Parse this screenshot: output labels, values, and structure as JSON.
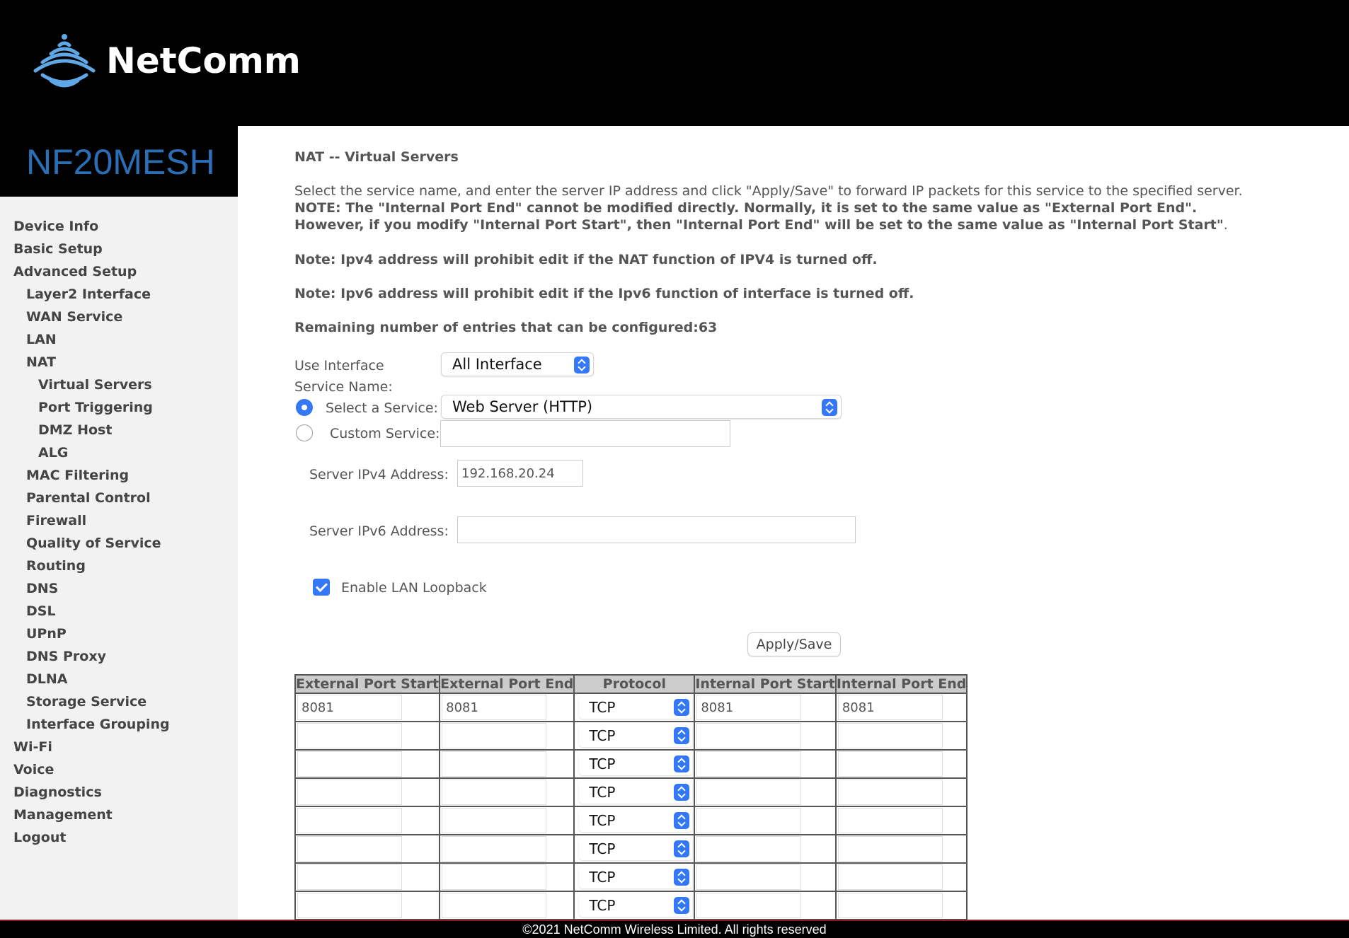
{
  "brand": {
    "logo_text": "NetComm",
    "model": "NF20MESH"
  },
  "nav": [
    {
      "label": "Device Info",
      "level": 0
    },
    {
      "label": "Basic Setup",
      "level": 0
    },
    {
      "label": "Advanced Setup",
      "level": 0
    },
    {
      "label": "Layer2 Interface",
      "level": 1
    },
    {
      "label": "WAN Service",
      "level": 1
    },
    {
      "label": "LAN",
      "level": 1
    },
    {
      "label": "NAT",
      "level": 1
    },
    {
      "label": "Virtual Servers",
      "level": 2
    },
    {
      "label": "Port Triggering",
      "level": 2
    },
    {
      "label": "DMZ Host",
      "level": 2
    },
    {
      "label": "ALG",
      "level": 2
    },
    {
      "label": "MAC Filtering",
      "level": 1
    },
    {
      "label": "Parental Control",
      "level": 1
    },
    {
      "label": "Firewall",
      "level": 1
    },
    {
      "label": "Quality of Service",
      "level": 1
    },
    {
      "label": "Routing",
      "level": 1
    },
    {
      "label": "DNS",
      "level": 1
    },
    {
      "label": "DSL",
      "level": 1
    },
    {
      "label": "UPnP",
      "level": 1
    },
    {
      "label": "DNS Proxy",
      "level": 1
    },
    {
      "label": "DLNA",
      "level": 1
    },
    {
      "label": "Storage Service",
      "level": 1
    },
    {
      "label": "Interface Grouping",
      "level": 1
    },
    {
      "label": "Wi-Fi",
      "level": 0
    },
    {
      "label": "Voice",
      "level": 0
    },
    {
      "label": "Diagnostics",
      "level": 0
    },
    {
      "label": "Management",
      "level": 0
    },
    {
      "label": "Logout",
      "level": 0
    }
  ],
  "page": {
    "title": "NAT -- Virtual Servers",
    "desc_normal": "Select the service name, and enter the server IP address and click \"Apply/Save\" to forward IP packets for this service to the specified server. ",
    "desc_bold": "NOTE: The \"Internal Port End\" cannot be modified directly. Normally, it is set to the same value as \"External Port End\". However, if you modify \"Internal Port Start\", then \"Internal Port End\" will be set to the same value as \"Internal Port Start\"",
    "desc_end": ".",
    "note_ipv4": "Note: Ipv4 address will prohibit edit if the NAT function of IPV4 is turned off.",
    "note_ipv6": "Note: Ipv6 address will prohibit edit if the Ipv6 function of interface is turned off.",
    "remaining": "Remaining number of entries that can be configured:63"
  },
  "form": {
    "use_interface_label": "Use Interface",
    "use_interface_value": "All Interface",
    "service_name_label": "Service Name:",
    "select_service_label": "Select a Service:",
    "select_service_value": "Web Server (HTTP)",
    "custom_service_label": "Custom Service:",
    "custom_service_value": "",
    "ipv4_label": "Server IPv4 Address:",
    "ipv4_value": "192.168.20.24",
    "ipv6_label": "Server IPv6 Address:",
    "ipv6_value": "",
    "loopback_label": "Enable LAN Loopback",
    "loopback_checked": true,
    "apply_label": "Apply/Save"
  },
  "table": {
    "headers": [
      "External Port Start",
      "External Port End",
      "Protocol",
      "Internal Port Start",
      "Internal Port End"
    ],
    "rows": [
      {
        "ext_start": "8081",
        "ext_end": "8081",
        "protocol": "TCP",
        "int_start": "8081",
        "int_end": "8081"
      },
      {
        "ext_start": "",
        "ext_end": "",
        "protocol": "TCP",
        "int_start": "",
        "int_end": ""
      },
      {
        "ext_start": "",
        "ext_end": "",
        "protocol": "TCP",
        "int_start": "",
        "int_end": ""
      },
      {
        "ext_start": "",
        "ext_end": "",
        "protocol": "TCP",
        "int_start": "",
        "int_end": ""
      },
      {
        "ext_start": "",
        "ext_end": "",
        "protocol": "TCP",
        "int_start": "",
        "int_end": ""
      },
      {
        "ext_start": "",
        "ext_end": "",
        "protocol": "TCP",
        "int_start": "",
        "int_end": ""
      },
      {
        "ext_start": "",
        "ext_end": "",
        "protocol": "TCP",
        "int_start": "",
        "int_end": ""
      },
      {
        "ext_start": "",
        "ext_end": "",
        "protocol": "TCP",
        "int_start": "",
        "int_end": ""
      }
    ]
  },
  "footer": "©2021 NetComm Wireless Limited. All rights reserved",
  "colors": {
    "accent": "#3478f6",
    "model_text": "#2a6fb5",
    "header_bg": "#000000",
    "sidebar_bg": "#f2f2f2"
  }
}
